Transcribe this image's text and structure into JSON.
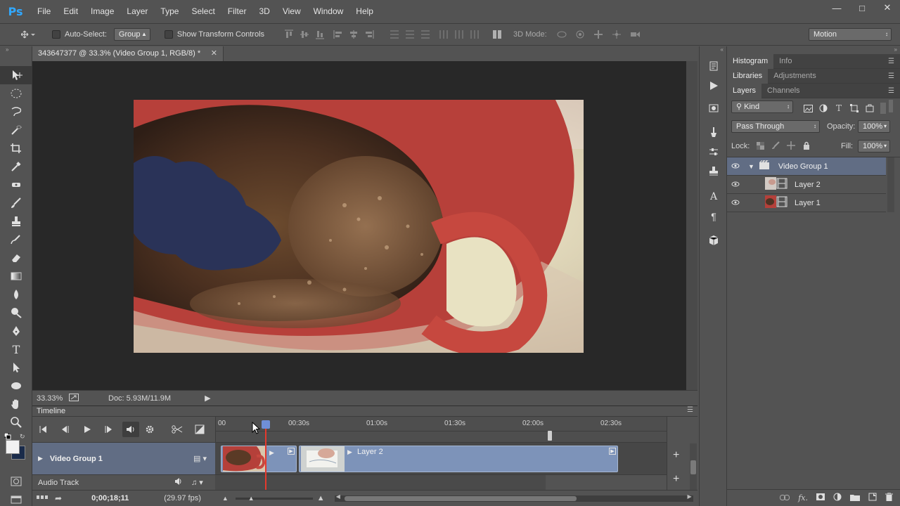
{
  "app": {
    "logo": "Ps",
    "menu": [
      "File",
      "Edit",
      "Image",
      "Layer",
      "Type",
      "Select",
      "Filter",
      "3D",
      "View",
      "Window",
      "Help"
    ],
    "window_controls": [
      "minimize-icon",
      "maximize-icon",
      "close-icon"
    ]
  },
  "options": {
    "auto_select_label": "Auto-Select:",
    "auto_select_value": "Group",
    "show_transform_label": "Show Transform Controls",
    "mode_3d_label": "3D Mode:",
    "workspace": "Motion"
  },
  "document": {
    "tab_title": "343647377 @ 33.3% (Video Group 1, RGB/8) *",
    "zoom": "33.33%",
    "doc_size": "Doc: 5.93M/11.9M"
  },
  "timeline": {
    "panel_title": "Timeline",
    "ruler": [
      "00",
      "00:30s",
      "01:00s",
      "01:30s",
      "02:00s",
      "02:30s"
    ],
    "video_group": "Video Group 1",
    "clip_label": "Layer 2",
    "audio_track": "Audio Track",
    "timecode": "0;00;18;11",
    "framerate": "(29.97 fps)",
    "playhead_fraction": 0.11
  },
  "panels": {
    "row1_tabs": [
      "Histogram",
      "Info"
    ],
    "row2_tabs": [
      "Libraries",
      "Adjustments"
    ],
    "row3_tabs": [
      "Layers",
      "Channels"
    ],
    "filter_kind": "Kind",
    "blend_mode": "Pass Through",
    "opacity_label": "Opacity:",
    "opacity_value": "100%",
    "lock_label": "Lock:",
    "fill_label": "Fill:",
    "fill_value": "100%",
    "layers": [
      {
        "name": "Video Group 1",
        "type": "group"
      },
      {
        "name": "Layer 2",
        "type": "video"
      },
      {
        "name": "Layer 1",
        "type": "video"
      }
    ]
  },
  "colors": {
    "accent": "#31a8ff",
    "group_highlight": "#616d84",
    "clip": "#7d93b9",
    "playhead": "#e5392d"
  }
}
